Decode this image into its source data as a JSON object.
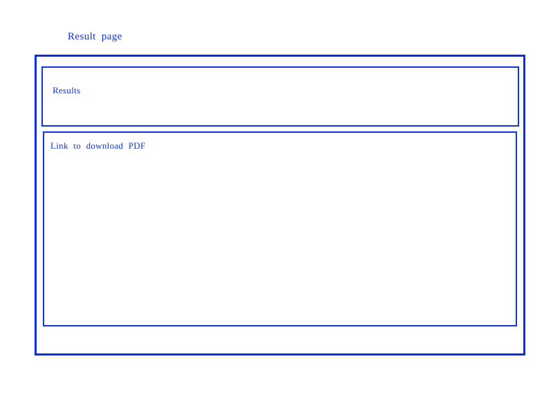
{
  "page": {
    "title": "Result page"
  },
  "results_section": {
    "label": "Results"
  },
  "download_section": {
    "link_text": "Link to download PDF"
  },
  "colors": {
    "accent": "#1133dd",
    "frame": "#0a2ee8",
    "background": "#ffffff"
  }
}
